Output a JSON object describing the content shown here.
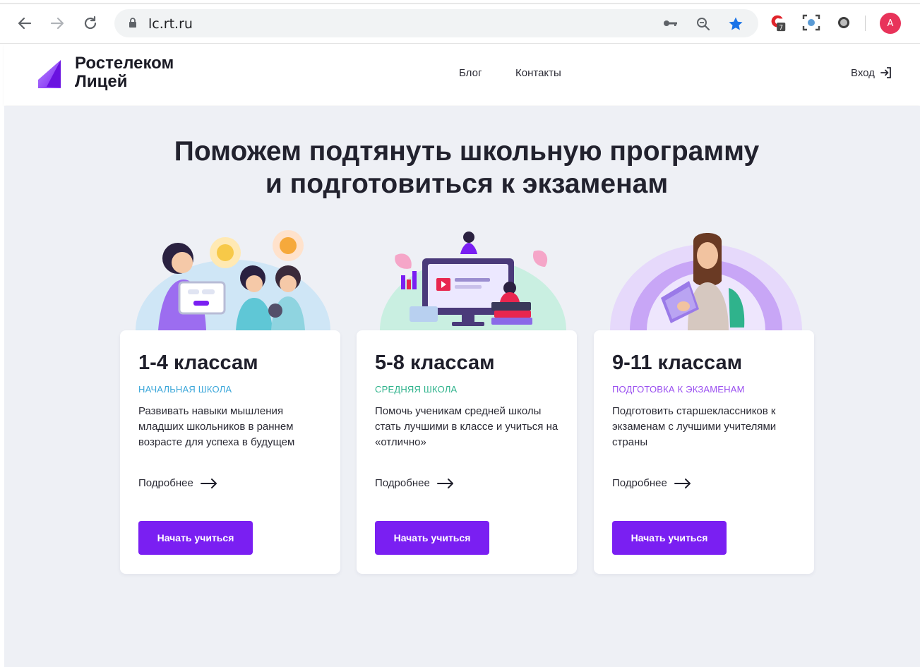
{
  "browser": {
    "url": "lc.rt.ru",
    "extension_badge": "7",
    "profile_initial": "A",
    "icons": [
      "back-arrow-icon",
      "forward-arrow-icon",
      "reload-icon",
      "lock-icon",
      "key-icon",
      "zoom-icon",
      "star-icon",
      "extension-icon",
      "screenshot-icon",
      "circle-extension-icon"
    ]
  },
  "header": {
    "logo_line1": "Ростелеком",
    "logo_line2": "Лицей",
    "nav": [
      "Блог",
      "Контакты"
    ],
    "login_label": "Вход"
  },
  "hero": {
    "title_line1": "Поможем подтянуть школьную программу",
    "title_line2": "и подготовиться к экзаменам"
  },
  "cards": [
    {
      "title": "1-4 классам",
      "tag": "НАЧАЛЬНАЯ ШКОЛА",
      "tag_color": "#3aa6d9",
      "description": "Развивать навыки мышления младших школьников в раннем возрасте для успеха в будущем",
      "more_label": "Подробнее",
      "button_label": "Начать учиться"
    },
    {
      "title": "5-8 классам",
      "tag": "СРЕДНЯЯ ШКОЛА",
      "tag_color": "#2fb38c",
      "description": "Помочь ученикам средней школы стать лучшими в классе и учиться на «отлично»",
      "more_label": "Подробнее",
      "button_label": "Начать учиться"
    },
    {
      "title": "9-11 классам",
      "tag": "ПОДГОТОВКА К ЭКЗАМЕНАМ",
      "tag_color": "#9a4ff0",
      "description": "Подготовить старшеклассников к экзаменам с лучшими учителями страны",
      "more_label": "Подробнее",
      "button_label": "Начать учиться"
    }
  ],
  "colors": {
    "accent": "#7a1ff2",
    "page_background": "#eef0f5"
  }
}
